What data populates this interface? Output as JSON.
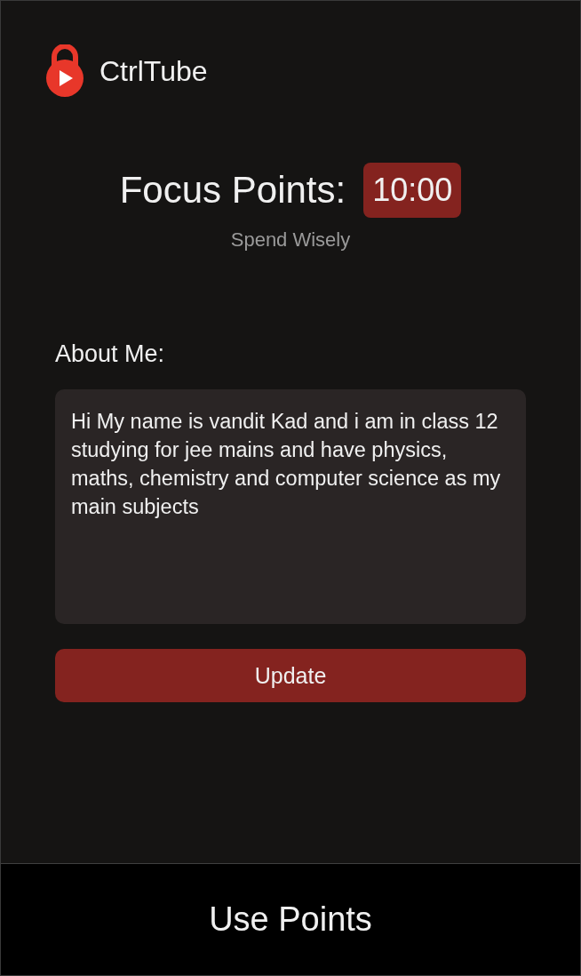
{
  "app": {
    "name": "CtrlTube"
  },
  "focus": {
    "label": "Focus Points:",
    "value": "10:00",
    "subtitle": "Spend Wisely"
  },
  "about": {
    "label": "About Me:",
    "value": "Hi My name is vandit Kad and i am in class 12 studying for jee mains and have physics, maths, chemistry and computer science as my main subjects"
  },
  "update_button": "Update",
  "bottom_button": "Use Points"
}
